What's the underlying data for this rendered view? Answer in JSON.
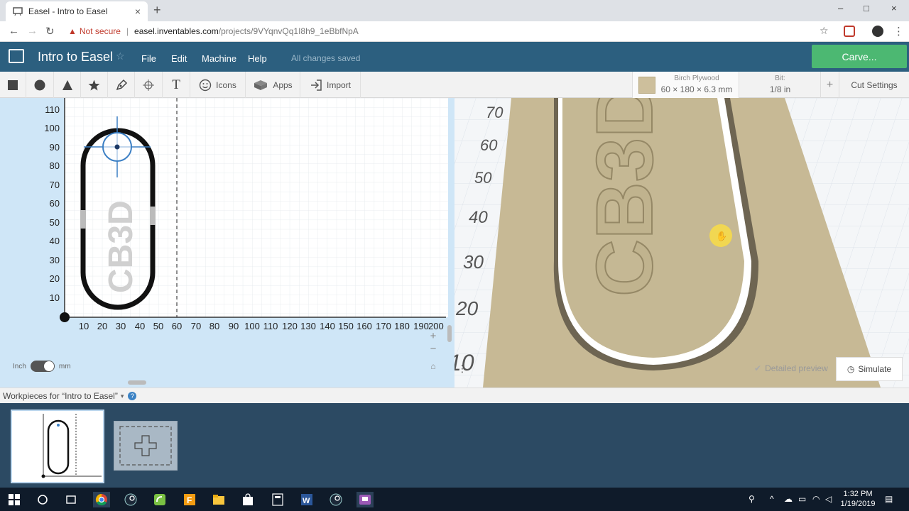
{
  "browser": {
    "tab_title": "Easel - Intro to Easel",
    "tab_close": "×",
    "new_tab": "+",
    "not_secure": "Not secure",
    "url_host": "easel.inventables.com",
    "url_path": "/projects/9VYqnvQq1I8h9_1eBbfNpA",
    "window_controls": [
      "–",
      "□",
      "×"
    ]
  },
  "app": {
    "project_title": "Intro to Easel",
    "menu": [
      "File",
      "Edit",
      "Machine",
      "Help"
    ],
    "save_status": "All changes saved",
    "carve_label": "Carve...",
    "accent_color": "#4cb872",
    "header_color": "#2c5f7f"
  },
  "toolbar": {
    "shape_tools": [
      "square-icon",
      "circle-icon",
      "triangle-icon",
      "star-icon",
      "pen-icon",
      "target-icon",
      "text-icon"
    ],
    "icons_label": "Icons",
    "apps_label": "Apps",
    "import_label": "Import",
    "material_name": "Birch Plywood",
    "material_dims": "60 × 180 × 6.3 mm",
    "bit_label": "Bit:",
    "bit_value": "1/8 in",
    "add_label": "+",
    "cut_settings_label": "Cut Settings"
  },
  "design": {
    "y_ticks": [
      "110",
      "100",
      "90",
      "80",
      "70",
      "60",
      "50",
      "40",
      "30",
      "20",
      "10"
    ],
    "x_ticks": [
      "10",
      "20",
      "30",
      "40",
      "50",
      "60",
      "70",
      "80",
      "90",
      "100",
      "110",
      "120",
      "130",
      "140",
      "150",
      "160",
      "170",
      "180",
      "190",
      "200"
    ],
    "unit_inch": "Inch",
    "unit_mm": "mm",
    "zoom_in": "+",
    "zoom_out": "−",
    "shape_text": "CB3D"
  },
  "preview": {
    "axis_labels": [
      "70",
      "60",
      "50",
      "40",
      "30",
      "20",
      "10"
    ],
    "detailed_preview_label": "Detailed preview",
    "simulate_label": "Simulate"
  },
  "workpieces": {
    "title": "Workpieces for “Intro to Easel”",
    "help": "?"
  },
  "taskbar": {
    "time": "1:32 PM",
    "date": "1/19/2019"
  }
}
